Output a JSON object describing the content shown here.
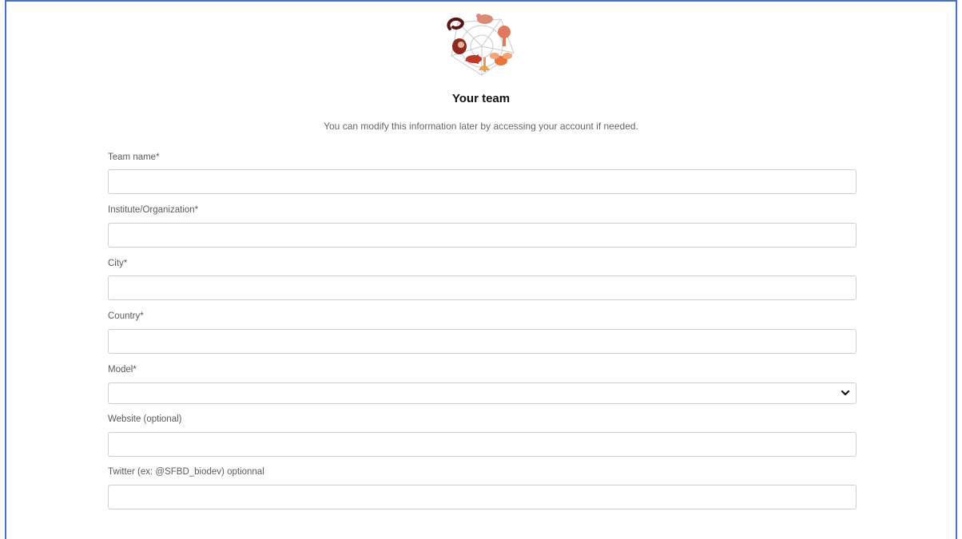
{
  "form": {
    "title": "Your team",
    "subtitle": "You can modify this information later by accessing your account if needed.",
    "fields": {
      "team_name": {
        "label": "Team name*",
        "value": ""
      },
      "institute": {
        "label": "Institute/Organization*",
        "value": ""
      },
      "city": {
        "label": "City*",
        "value": ""
      },
      "country": {
        "label": "Country*",
        "value": ""
      },
      "model": {
        "label": "Model*",
        "selected": ""
      },
      "website": {
        "label": "Website (optional)",
        "value": ""
      },
      "twitter": {
        "label": "Twitter (ex: @SFBD_biodev) optionnal",
        "value": ""
      }
    }
  },
  "icons": {
    "logo": "model-organisms-logo",
    "select_arrow": "chevron-down-icon"
  },
  "colors": {
    "frame_border": "#4472c4",
    "logo_dark": "#7a1f1f",
    "logo_mid": "#c8553d",
    "logo_light": "#f0a070"
  }
}
